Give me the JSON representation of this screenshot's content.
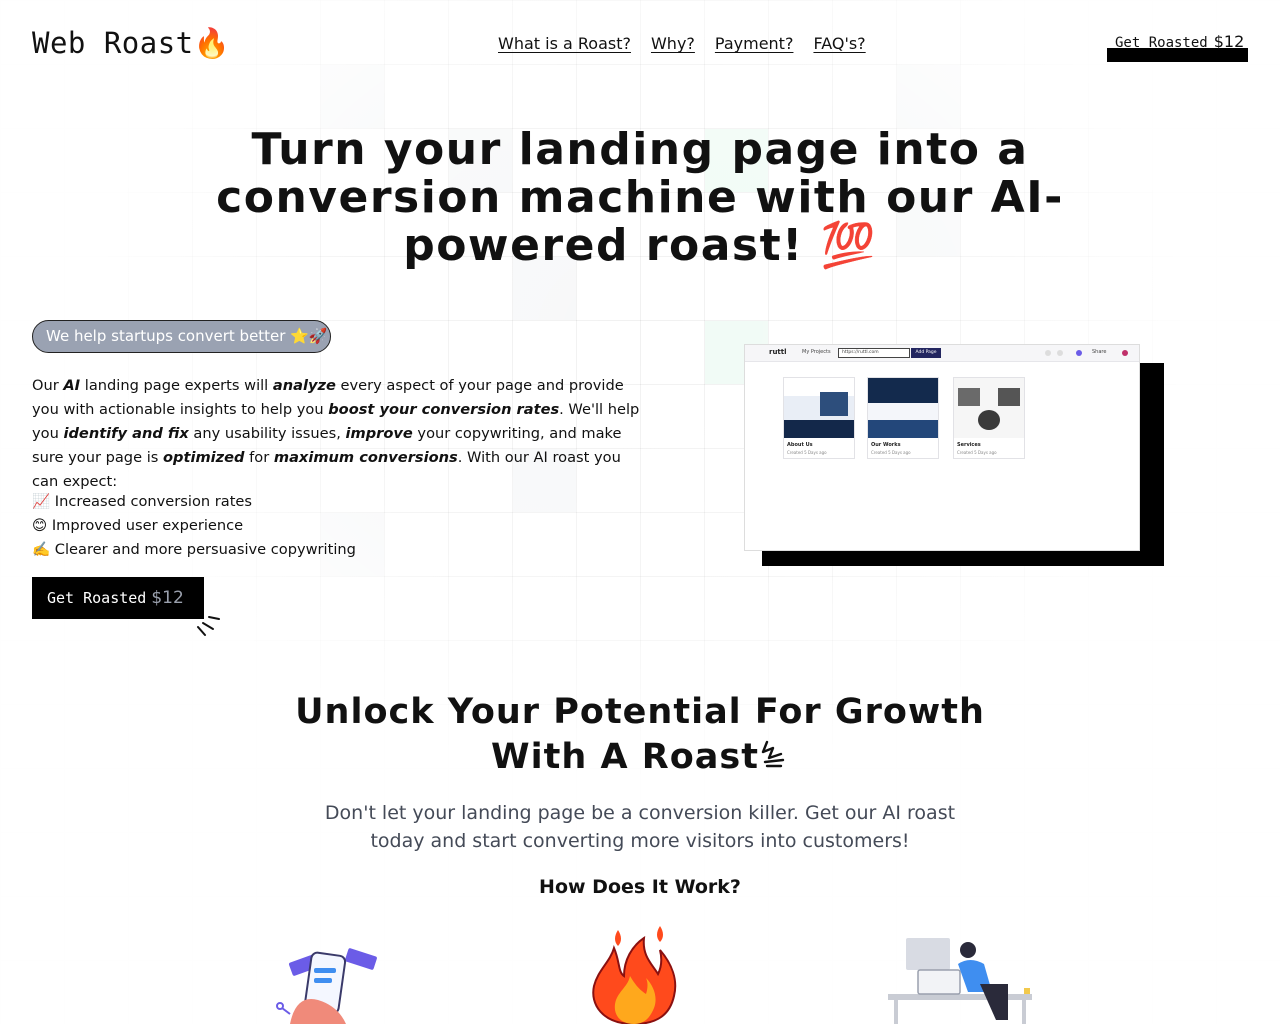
{
  "header": {
    "logo_text": "Web Roast",
    "logo_emoji": "🔥",
    "nav": [
      "What is a Roast?",
      "Why?",
      "Payment?",
      "FAQ's?"
    ],
    "cta_label": "Get Roasted",
    "cta_price": "$12"
  },
  "hero": {
    "headline": "Turn your landing page into a conversion machine with our AI-powered roast! 💯",
    "pill": "We help startups convert better ⭐🚀",
    "intro": {
      "t1": "Our ",
      "e1": "AI",
      "t2": " landing page experts will ",
      "e2": "analyze",
      "t3": " every aspect of your page and provide you with actionable insights to help you ",
      "e3": "boost your conversion rates",
      "t4": ". We'll help you ",
      "e4": "identify and fix",
      "t5": " any usability issues, ",
      "e5": "improve",
      "t6": " your copywriting, and make sure your page is ",
      "e6": "optimized",
      "t7": " for ",
      "e7": "maximum conversions",
      "t8": ". With our AI roast you can expect:"
    },
    "benefits": [
      "📈 Increased conversion rates",
      "😊 Improved user experience",
      "✍️ Clearer and more persuasive copywriting"
    ],
    "cta_label": "Get Roasted",
    "cta_price": "$12"
  },
  "preview": {
    "logo": "ruttl",
    "tab": "My Projects",
    "url": "https://ruttl.com",
    "go": "Add Page",
    "share": "Share",
    "cards": [
      {
        "title": "About Us",
        "sub": "Created 5 Days ago"
      },
      {
        "title": "Our Works",
        "sub": "Created 5 Days ago"
      },
      {
        "title": "Services",
        "sub": "Created 5 Days ago"
      }
    ]
  },
  "section2": {
    "heading_line1": "Unlock Your Potential For Growth",
    "heading_line2": "With A Roast",
    "subtext": "Don't let your landing page be a conversion killer. Get our AI roast today and start converting more visitors into customers!",
    "how": "How Does It Work?"
  },
  "colors": {
    "pill_bg": "#9aa2b2",
    "cta_bg": "#000000",
    "price_muted": "#9aa0ad",
    "fire": "#ff4a1c",
    "accent_blue": "#3f8ef0",
    "accent_purple": "#6b5ce7"
  },
  "icons": [
    "fire-icon",
    "hundred-points-icon",
    "sparks-icon",
    "zap-icon",
    "phone-money-illustration",
    "fire-illustration",
    "person-laptop-illustration"
  ]
}
